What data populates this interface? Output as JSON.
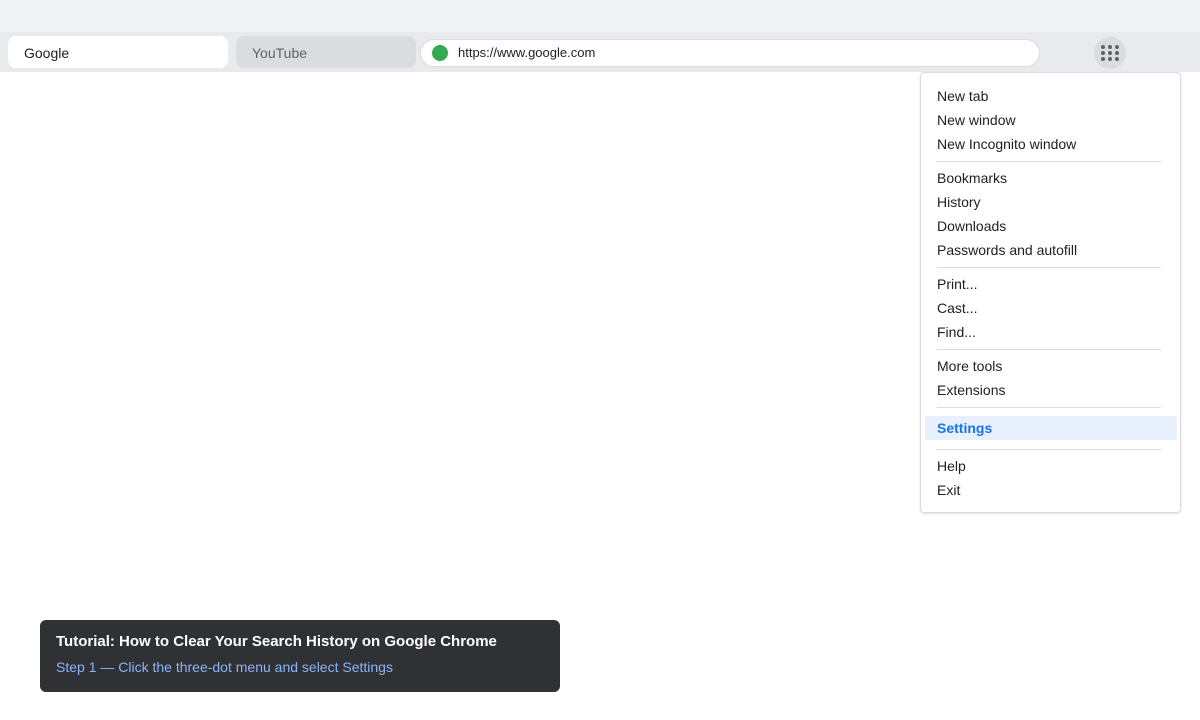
{
  "browser": {
    "tabs": [
      {
        "label": "Google",
        "active": true
      },
      {
        "label": "YouTube",
        "active": false
      }
    ],
    "omnibox": {
      "url": "https://www.google.com",
      "secure_icon": "secure-site-icon"
    },
    "menu_button_icon": "app-menu-dots-icon"
  },
  "menu": {
    "groups": [
      [
        "New tab",
        "New window",
        "New Incognito window"
      ],
      [
        "Bookmarks",
        "History",
        "Downloads",
        "Passwords and autofill"
      ],
      [
        "Print...",
        "Cast...",
        "Find..."
      ],
      [
        "More tools",
        "Extensions"
      ],
      [
        "Settings"
      ],
      [
        "Help",
        "Exit"
      ]
    ],
    "highlighted": "Settings"
  },
  "caption": {
    "title": "Tutorial: How to Clear Your Search History on Google Chrome",
    "step": "Step 1 — Click the three-dot menu and select Settings"
  },
  "colors": {
    "accent": "#1a73e8",
    "highlight_bg": "#e8f0fe",
    "secure": "#34a853",
    "caption_bg": "#303134",
    "caption_step": "#8ab4f8"
  }
}
